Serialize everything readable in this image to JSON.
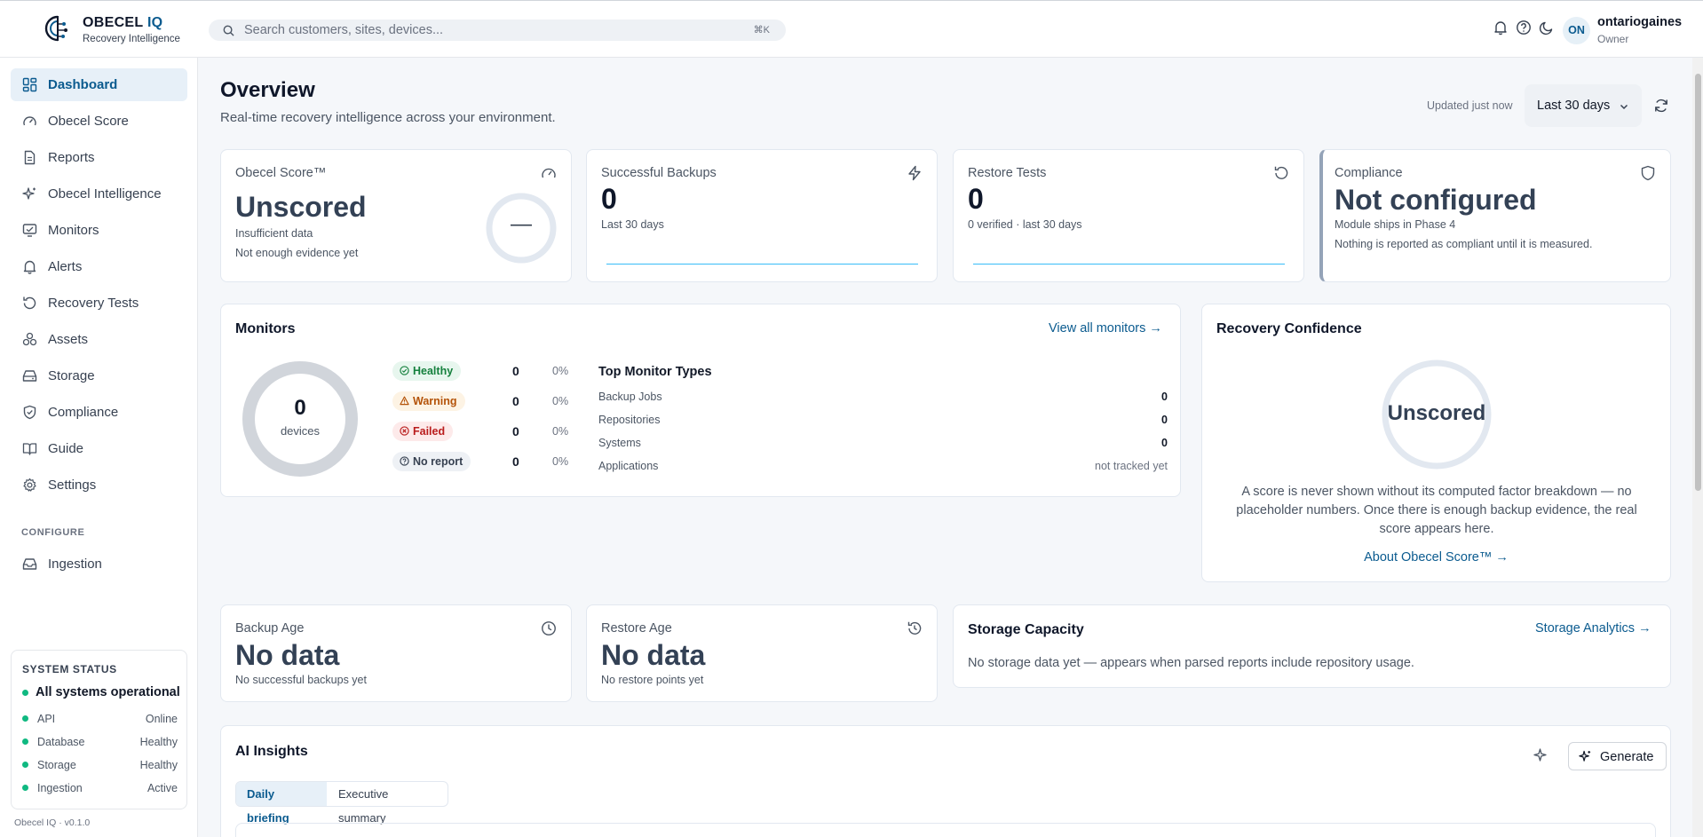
{
  "header": {
    "brand_name": "OBECEL",
    "brand_accent": "IQ",
    "brand_sub": "Recovery Intelligence",
    "search_placeholder": "Search customers, sites, devices...",
    "search_shortcut": "⌘K",
    "user_initials": "ON",
    "user_name": "ontariogaines",
    "user_role": "Owner"
  },
  "sidebar": {
    "items": [
      {
        "label": "Dashboard",
        "icon": "dashboard-icon",
        "active": true
      },
      {
        "label": "Obecel Score",
        "icon": "gauge-icon"
      },
      {
        "label": "Reports",
        "icon": "file-icon"
      },
      {
        "label": "Obecel Intelligence",
        "icon": "sparkles-icon"
      },
      {
        "label": "Monitors",
        "icon": "monitor-icon"
      },
      {
        "label": "Alerts",
        "icon": "bell-icon"
      },
      {
        "label": "Recovery Tests",
        "icon": "rotate-icon"
      },
      {
        "label": "Assets",
        "icon": "boxes-icon"
      },
      {
        "label": "Storage",
        "icon": "hard-drive-icon"
      },
      {
        "label": "Compliance",
        "icon": "shield-check-icon"
      },
      {
        "label": "Guide",
        "icon": "book-icon"
      },
      {
        "label": "Settings",
        "icon": "gear-icon"
      }
    ],
    "section_label": "CONFIGURE",
    "configure_items": [
      {
        "label": "Ingestion",
        "icon": "inbox-icon"
      }
    ],
    "status": {
      "title": "SYSTEM STATUS",
      "main": "All systems operational",
      "rows": [
        {
          "name": "API",
          "value": "Online"
        },
        {
          "name": "Database",
          "value": "Healthy"
        },
        {
          "name": "Storage",
          "value": "Healthy"
        },
        {
          "name": "Ingestion",
          "value": "Active"
        }
      ]
    },
    "version": "Obecel IQ · v0.1.0"
  },
  "main": {
    "title": "Overview",
    "subtitle": "Real-time recovery intelligence across your environment.",
    "updated": "Updated just now",
    "range": "Last 30 days",
    "score_card": {
      "label": "Obecel Score™",
      "value": "Unscored",
      "line1": "Insufficient data",
      "line2": "Not enough evidence yet",
      "ring_text": "—"
    },
    "backups_card": {
      "label": "Successful Backups",
      "value": "0",
      "sub": "Last 30 days"
    },
    "restore_card": {
      "label": "Restore Tests",
      "value": "0",
      "sub": "0 verified · last 30 days"
    },
    "compliance_card": {
      "label": "Compliance",
      "value": "Not configured",
      "line1": "Module ships in Phase 4",
      "line2": "Nothing is reported as compliant until it is measured."
    },
    "monitors": {
      "title": "Monitors",
      "link": "View all monitors →",
      "total": "0",
      "total_label": "devices",
      "statuses": [
        {
          "label": "Healthy",
          "count": "0",
          "pct": "0%"
        },
        {
          "label": "Warning",
          "count": "0",
          "pct": "0%"
        },
        {
          "label": "Failed",
          "count": "0",
          "pct": "0%"
        },
        {
          "label": "No report",
          "count": "0",
          "pct": "0%"
        }
      ],
      "types_title": "Top Monitor Types",
      "types": [
        {
          "name": "Backup Jobs",
          "value": "0"
        },
        {
          "name": "Repositories",
          "value": "0"
        },
        {
          "name": "Systems",
          "value": "0"
        },
        {
          "name": "Applications",
          "value": "not tracked yet"
        }
      ]
    },
    "confidence": {
      "title": "Recovery Confidence",
      "value": "Unscored",
      "text": "A score is never shown without its computed factor breakdown — no placeholder numbers. Once there is enough backup evidence, the real score appears here.",
      "link": "About Obecel Score™ →"
    },
    "backup_age": {
      "label": "Backup Age",
      "value": "No data",
      "sub": "No successful backups yet"
    },
    "restore_age": {
      "label": "Restore Age",
      "value": "No data",
      "sub": "No restore points yet"
    },
    "storage": {
      "title": "Storage Capacity",
      "link": "Storage Analytics →",
      "text": "No storage data yet — appears when parsed reports include repository usage."
    },
    "insights": {
      "title": "AI Insights",
      "generate": "Generate",
      "tabs": [
        "Daily briefing",
        "Executive summary"
      ]
    }
  },
  "colors": {
    "accent": "#0b5b8f",
    "ok": "#10b981",
    "warn": "#b45309",
    "fail": "#b91c1c"
  }
}
